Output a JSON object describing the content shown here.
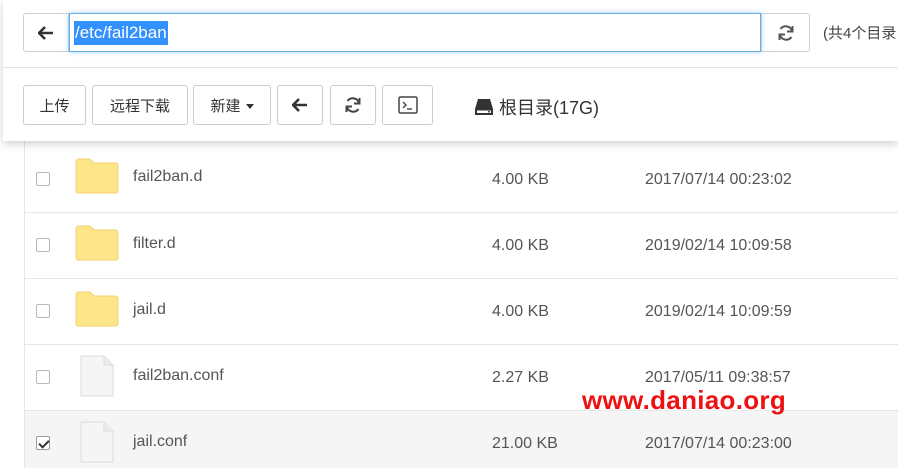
{
  "addressbar": {
    "path": "/etc/fail2ban",
    "summary": "(共4个目录"
  },
  "toolbar": {
    "upload_label": "上传",
    "remote_download_label": "远程下载",
    "new_label": "新建",
    "disk_label": "根目录(17G)"
  },
  "files": [
    {
      "name": "fail2ban.d",
      "size": "4.00 KB",
      "date": "2017/07/14 00:23:02",
      "type": "folder",
      "checked": false
    },
    {
      "name": "filter.d",
      "size": "4.00 KB",
      "date": "2019/02/14 10:09:58",
      "type": "folder",
      "checked": false
    },
    {
      "name": "jail.d",
      "size": "4.00 KB",
      "date": "2019/02/14 10:09:59",
      "type": "folder",
      "checked": false
    },
    {
      "name": "fail2ban.conf",
      "size": "2.27 KB",
      "date": "2017/05/11 09:38:57",
      "type": "file",
      "checked": false
    },
    {
      "name": "jail.conf",
      "size": "21.00 KB",
      "date": "2017/07/14 00:23:00",
      "type": "file",
      "checked": true
    }
  ],
  "watermark": "www.daniao.org",
  "colors": {
    "folder": "#fde58a",
    "selection": "#3390ff",
    "watermark": "#ee1111"
  }
}
